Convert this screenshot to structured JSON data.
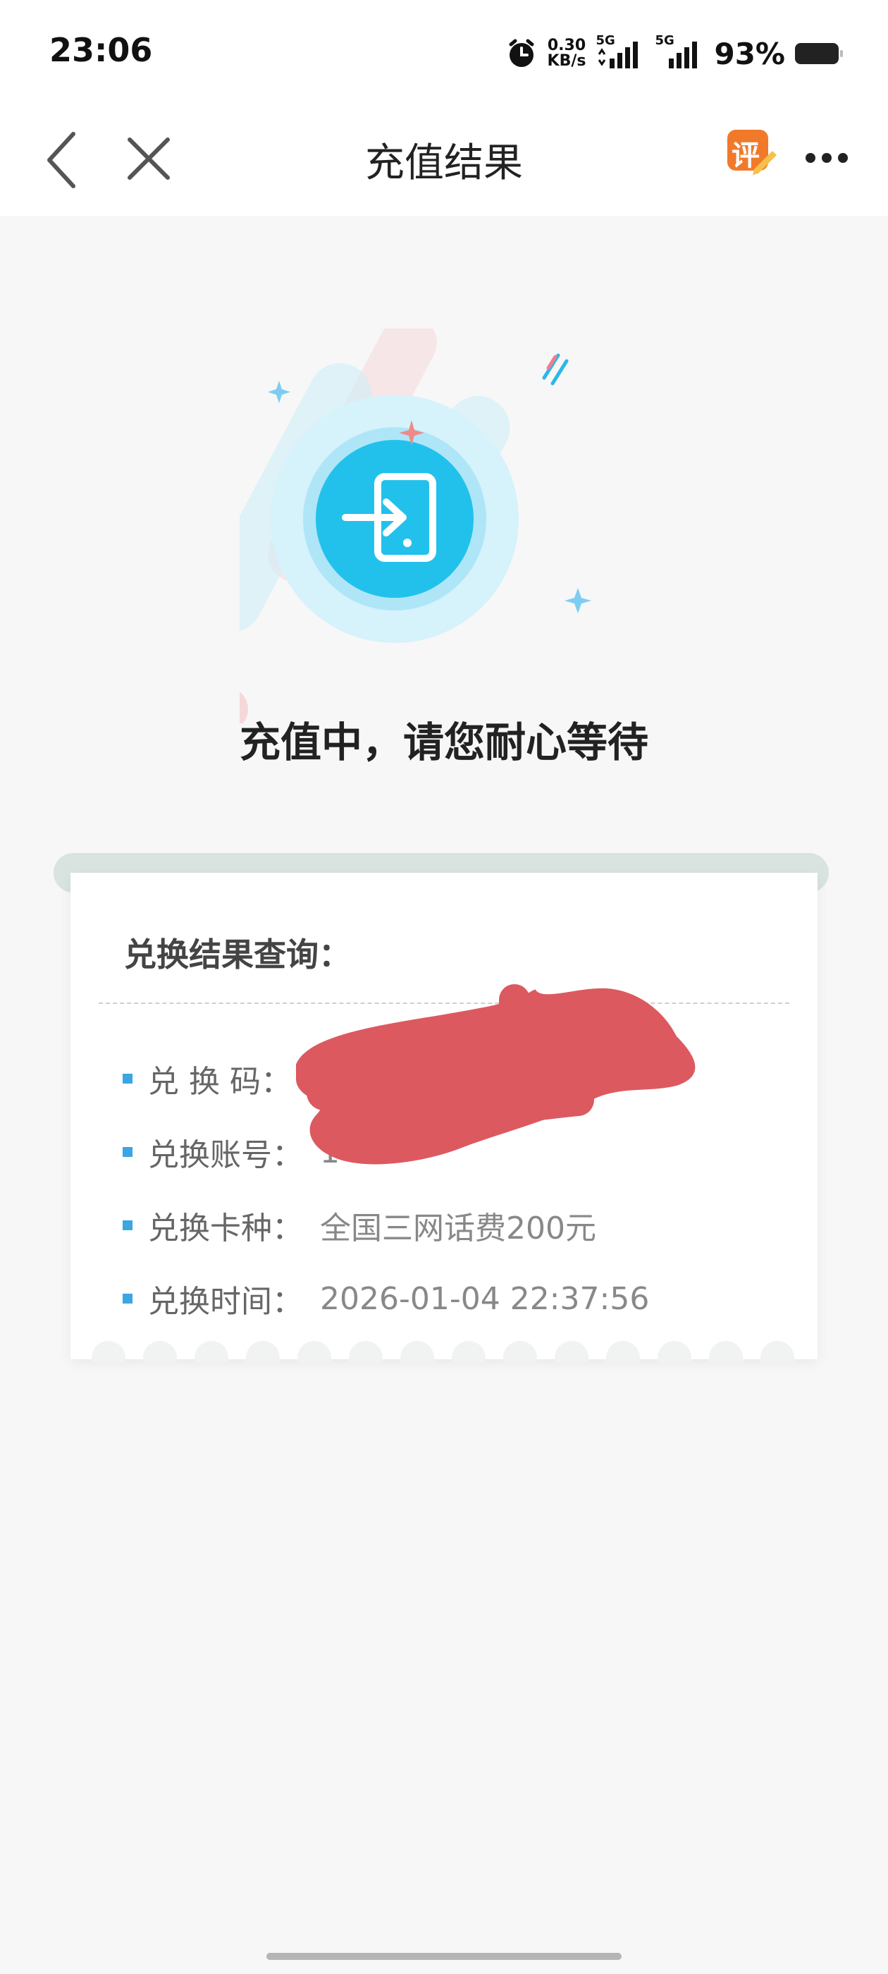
{
  "status_bar": {
    "time": "23:06",
    "net_speed_value": "0.30",
    "net_speed_unit": "KB/s",
    "sim1_label": "5G",
    "sim2_label": "5G",
    "battery": "93%"
  },
  "nav": {
    "title": "充值结果",
    "review_badge": "评"
  },
  "status_message": "充值中，请您耐心等待",
  "result_card": {
    "heading": "兑换结果查询：",
    "rows": [
      {
        "label": "兑 换 码：",
        "value": ""
      },
      {
        "label": "兑换账号：",
        "value": "1"
      },
      {
        "label": "兑换卡种：",
        "value": "全国三网话费200元"
      },
      {
        "label": "兑换时间：",
        "value": "2026-01-04 22:37:56"
      }
    ]
  },
  "colors": {
    "accent": "#3aa6e2",
    "icon_blue": "#23c3ea",
    "redaction": "#dc5960",
    "badge": "#f07a2a"
  }
}
